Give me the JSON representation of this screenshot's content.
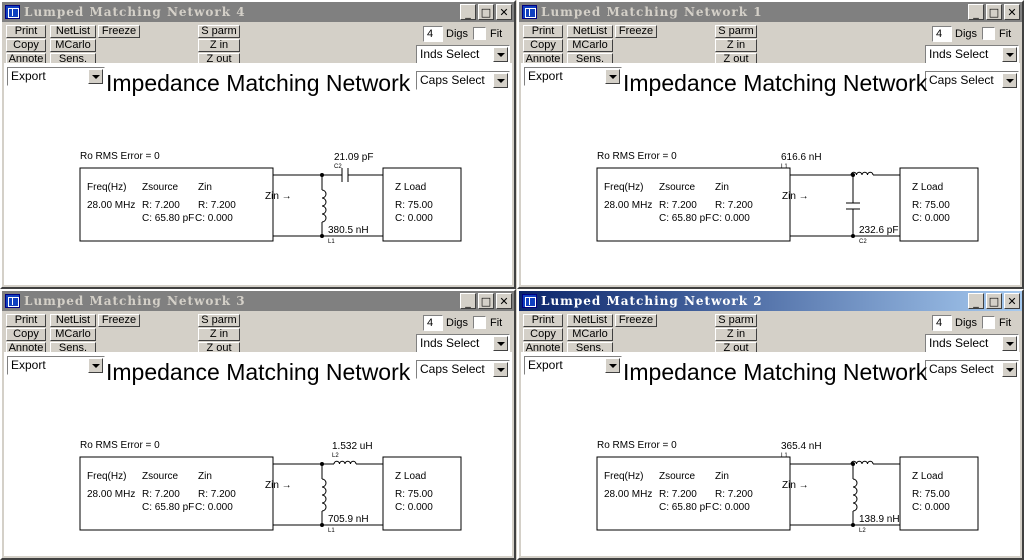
{
  "ui": {
    "print": "Print",
    "netlist": "NetList",
    "freeze": "Freeze",
    "copy": "Copy",
    "mcarlo": "MCarlo",
    "annote": "Annote",
    "sens": "Sens.",
    "sparm": "S parm",
    "zin": "Z in",
    "zout": "Z out",
    "digs_value": "4",
    "digs_label": "Digs",
    "fit_label": "Fit",
    "inds_select": "Inds Select",
    "caps_select": "Caps Select",
    "export": "Export",
    "network_title": "Impedance Matching Network",
    "rms_error": "Ro RMS Error = 0",
    "freq_header": "Freq(Hz)",
    "zsource_header": "Zsource",
    "zin_header": "Zin",
    "freq_value": "28.00 MHz",
    "zsource_r": "R: 7.200",
    "zsource_c": "C: 65.80 pF",
    "zin_r": "R: 7.200",
    "zin_c": "C: 0.000",
    "zin_arrow": "Zin →",
    "zload_title": "Z Load",
    "zload_r": "R: 75.00",
    "zload_c": "C: 0.000",
    "minimize_glyph": "_",
    "maximize_glyph": "□",
    "close_glyph": "✕"
  },
  "windows": [
    {
      "title": "Lumped Matching Network 4",
      "active": false,
      "series": {
        "type": "capacitor",
        "value": "21.09 pF",
        "ref": "C2"
      },
      "shunt": {
        "type": "inductor",
        "value": "380.5 nH",
        "ref": "L1",
        "position": "left"
      }
    },
    {
      "title": "Lumped Matching Network 1",
      "active": false,
      "series": {
        "type": "inductor",
        "value": "616.6 nH",
        "ref": "L1"
      },
      "shunt": {
        "type": "capacitor",
        "value": "232.6 pF",
        "ref": "C2",
        "position": "right"
      }
    },
    {
      "title": "Lumped Matching Network 3",
      "active": false,
      "series": {
        "type": "inductor",
        "value": "1.532 uH",
        "ref": "L2"
      },
      "shunt": {
        "type": "inductor",
        "value": "705.9 nH",
        "ref": "L1",
        "position": "left"
      }
    },
    {
      "title": "Lumped Matching Network 2",
      "active": true,
      "series": {
        "type": "inductor",
        "value": "365.4 nH",
        "ref": "L1"
      },
      "shunt": {
        "type": "inductor",
        "value": "138.9 nH",
        "ref": "L2",
        "position": "right"
      }
    }
  ]
}
